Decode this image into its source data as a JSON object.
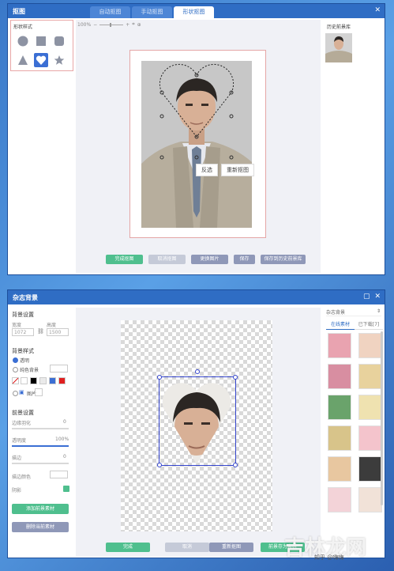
{
  "window1": {
    "title": "抠图",
    "tabs": [
      {
        "label": "自动抠图",
        "active": false
      },
      {
        "label": "手动抠图",
        "active": false
      },
      {
        "label": "形状抠图",
        "active": true
      }
    ],
    "shape_panel": {
      "title": "形状样式",
      "shapes": [
        "circle-icon",
        "square-icon",
        "rounded-square-icon",
        "triangle-icon",
        "heart-icon",
        "star-icon"
      ],
      "selected": "heart-icon"
    },
    "zoom": "100%",
    "context_menu": [
      "反选",
      "重新抠图"
    ],
    "buttons": [
      "完成抠图",
      "取消抠图",
      "更换图片",
      "保存",
      "保存到历史前景库"
    ],
    "history": {
      "title": "历史前景库"
    }
  },
  "window2": {
    "title": "杂志背景",
    "bg_settings": {
      "title": "背景设置",
      "width_label": "宽度",
      "height_label": "高度",
      "width": "1072",
      "height": "1500"
    },
    "bg_style": {
      "title": "背景样式",
      "transparent": "透明",
      "solid": "纯色背景",
      "image": "图片",
      "colors": [
        "#ffffff",
        "#000000",
        "#eaeaea",
        "#3c6fd4",
        "#e02020"
      ]
    },
    "fg_settings": {
      "title": "前景设置",
      "edge_label": "边缘羽化",
      "edge_value": "0",
      "edge_fraction": 0,
      "opacity_label": "透明度",
      "opacity_value": "100%",
      "opacity_fraction": 1.0,
      "stroke_label": "描边",
      "stroke_value": "0",
      "stroke_fraction": 0,
      "stroke_color_label": "描边颜色",
      "shadow_label": "阴影"
    },
    "side_buttons": [
      "添加前景素材",
      "删除当前素材"
    ],
    "material_panel": {
      "dropdown": "杂志背景",
      "tabs": [
        {
          "label": "在线素材",
          "active": true
        },
        {
          "label": "已下载[7]",
          "active": false
        }
      ],
      "items": [
        "#e9a3b0",
        "#f0d3c1",
        "#d88ea1",
        "#e8d29d",
        "#6aa36b",
        "#efe2b0",
        "#d8c48a",
        "#f4c4cc",
        "#e8c7a0",
        "#3c3c3c",
        "#f3d3d8",
        "#f1e2d8"
      ]
    },
    "buttons": [
      "完成",
      "取消",
      "重新抠图",
      "前景存为素材"
    ]
  },
  "watermark": {
    "big": "吉林龙网",
    "small": "知乎 @嗨嗨"
  }
}
